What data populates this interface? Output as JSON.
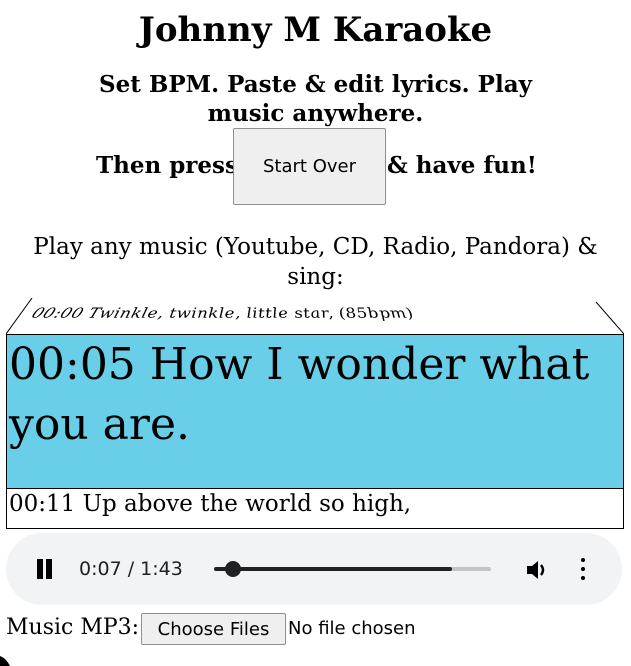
{
  "header": {
    "title": "Johnny M Karaoke",
    "subtitle": "Set BPM. Paste & edit lyrics. Play music anywhere.",
    "then_press": "Then press",
    "start_over_label": "Start Over",
    "have_fun": "& have fun!"
  },
  "instructions": "Play any music (Youtube, CD, Radio, Pandora) & sing:",
  "lyrics": {
    "previous": "00:00 Twinkle, twinkle, little star, (85bpm)",
    "current": "00:05 How I wonder what you are.",
    "next": "00:11 Up above the world so high,",
    "current_bg": "#69cfe8"
  },
  "player": {
    "state": "playing",
    "time": "0:07 / 1:43",
    "progress": 0.068,
    "buffered": 0.86,
    "icons": [
      "pause-icon",
      "volume-icon",
      "more-vert-icon"
    ]
  },
  "file_input": {
    "label": "Music MP3:",
    "button_label": "Choose Files",
    "status": "No file chosen"
  }
}
